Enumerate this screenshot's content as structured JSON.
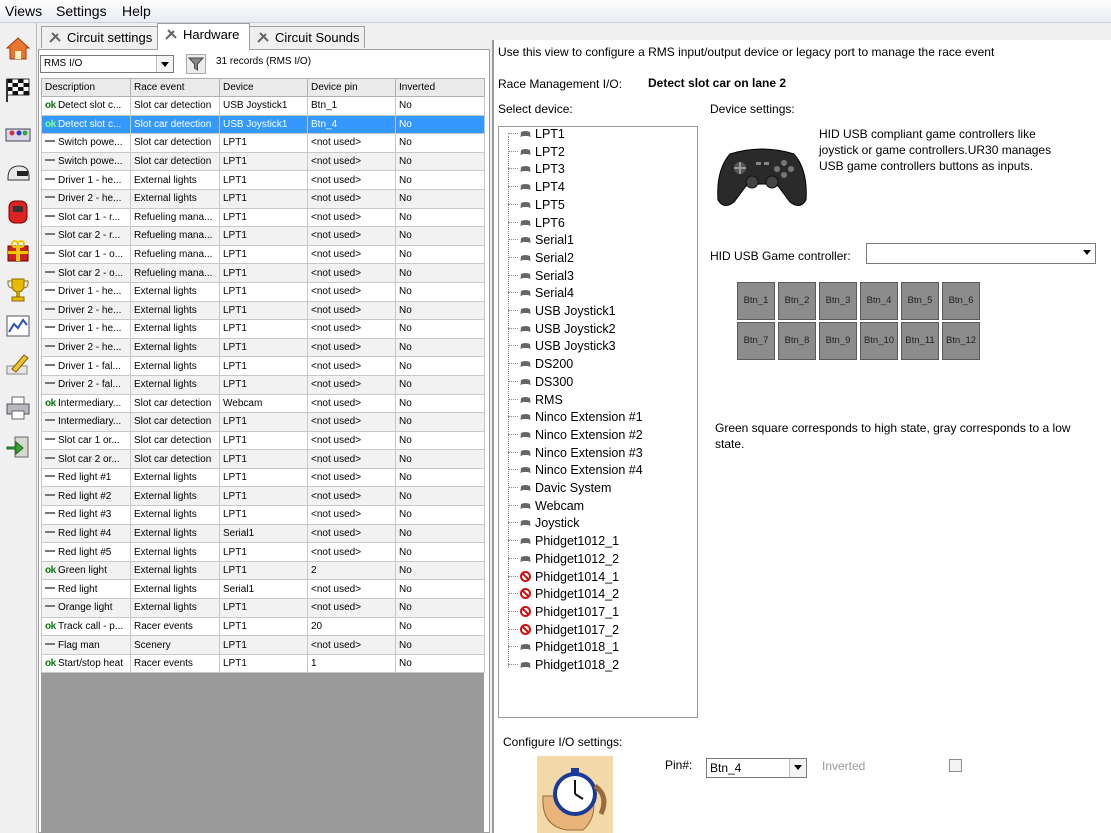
{
  "menu": [
    "Views",
    "Settings",
    "Help"
  ],
  "tabs": [
    {
      "label": "Circuit settings",
      "active": false
    },
    {
      "label": "Hardware",
      "active": true
    },
    {
      "label": "Circuit Sounds",
      "active": false
    }
  ],
  "left": {
    "filter_value": "RMS I/O",
    "record_count": "31 records (RMS I/O)",
    "columns": [
      "Description",
      "Race event",
      "Device",
      "Device pin",
      "Inverted"
    ],
    "rows": [
      {
        "status": "ok",
        "desc": "Detect slot c...",
        "event": "Slot car detection",
        "device": "USB Joystick1",
        "pin": "Btn_1",
        "inv": "No"
      },
      {
        "status": "ok",
        "desc": "Detect slot c...",
        "event": "Slot car detection",
        "device": "USB Joystick1",
        "pin": "Btn_4",
        "inv": "No",
        "selected": true
      },
      {
        "status": "dash",
        "desc": "Switch powe...",
        "event": "Slot car detection",
        "device": "LPT1",
        "pin": "<not used>",
        "inv": "No"
      },
      {
        "status": "dash",
        "desc": "Switch powe...",
        "event": "Slot car detection",
        "device": "LPT1",
        "pin": "<not used>",
        "inv": "No"
      },
      {
        "status": "dash",
        "desc": "Driver 1 - he...",
        "event": "External lights",
        "device": "LPT1",
        "pin": "<not used>",
        "inv": "No"
      },
      {
        "status": "dash",
        "desc": "Driver 2 - he...",
        "event": "External lights",
        "device": "LPT1",
        "pin": "<not used>",
        "inv": "No"
      },
      {
        "status": "dash",
        "desc": "Slot car 1 - r...",
        "event": "Refueling mana...",
        "device": "LPT1",
        "pin": "<not used>",
        "inv": "No"
      },
      {
        "status": "dash",
        "desc": "Slot car 2 - r...",
        "event": "Refueling mana...",
        "device": "LPT1",
        "pin": "<not used>",
        "inv": "No"
      },
      {
        "status": "dash",
        "desc": "Slot car 1 - o...",
        "event": "Refueling mana...",
        "device": "LPT1",
        "pin": "<not used>",
        "inv": "No"
      },
      {
        "status": "dash",
        "desc": "Slot car 2 - o...",
        "event": "Refueling mana...",
        "device": "LPT1",
        "pin": "<not used>",
        "inv": "No"
      },
      {
        "status": "dash",
        "desc": "Driver 1 - he...",
        "event": "External lights",
        "device": "LPT1",
        "pin": "<not used>",
        "inv": "No"
      },
      {
        "status": "dash",
        "desc": "Driver 2 - he...",
        "event": "External lights",
        "device": "LPT1",
        "pin": "<not used>",
        "inv": "No"
      },
      {
        "status": "dash",
        "desc": "Driver 1 - he...",
        "event": "External lights",
        "device": "LPT1",
        "pin": "<not used>",
        "inv": "No"
      },
      {
        "status": "dash",
        "desc": "Driver 2 - he...",
        "event": "External lights",
        "device": "LPT1",
        "pin": "<not used>",
        "inv": "No"
      },
      {
        "status": "dash",
        "desc": "Driver 1 - fal...",
        "event": "External lights",
        "device": "LPT1",
        "pin": "<not used>",
        "inv": "No"
      },
      {
        "status": "dash",
        "desc": "Driver 2 - fal...",
        "event": "External lights",
        "device": "LPT1",
        "pin": "<not used>",
        "inv": "No"
      },
      {
        "status": "ok",
        "desc": "Intermediary...",
        "event": "Slot car detection",
        "device": "Webcam",
        "pin": "<not used>",
        "inv": "No"
      },
      {
        "status": "dash",
        "desc": "Intermediary...",
        "event": "Slot car detection",
        "device": "LPT1",
        "pin": "<not used>",
        "inv": "No"
      },
      {
        "status": "dash",
        "desc": "Slot car 1 or...",
        "event": "Slot car detection",
        "device": "LPT1",
        "pin": "<not used>",
        "inv": "No"
      },
      {
        "status": "dash",
        "desc": "Slot car 2 or...",
        "event": "Slot car detection",
        "device": "LPT1",
        "pin": "<not used>",
        "inv": "No"
      },
      {
        "status": "dash",
        "desc": "Red light #1",
        "event": "External lights",
        "device": "LPT1",
        "pin": "<not used>",
        "inv": "No"
      },
      {
        "status": "dash",
        "desc": "Red light #2",
        "event": "External lights",
        "device": "LPT1",
        "pin": "<not used>",
        "inv": "No"
      },
      {
        "status": "dash",
        "desc": "Red light #3",
        "event": "External lights",
        "device": "LPT1",
        "pin": "<not used>",
        "inv": "No"
      },
      {
        "status": "dash",
        "desc": "Red light #4",
        "event": "External lights",
        "device": "Serial1",
        "pin": "<not used>",
        "inv": "No"
      },
      {
        "status": "dash",
        "desc": "Red light #5",
        "event": "External lights",
        "device": "LPT1",
        "pin": "<not used>",
        "inv": "No"
      },
      {
        "status": "ok",
        "desc": "Green light",
        "event": "External lights",
        "device": "LPT1",
        "pin": "2",
        "inv": "No"
      },
      {
        "status": "dash",
        "desc": "Red light",
        "event": "External lights",
        "device": "Serial1",
        "pin": "<not used>",
        "inv": "No"
      },
      {
        "status": "dash",
        "desc": "Orange light",
        "event": "External lights",
        "device": "LPT1",
        "pin": "<not used>",
        "inv": "No"
      },
      {
        "status": "ok",
        "desc": "Track call - p...",
        "event": "Racer events",
        "device": "LPT1",
        "pin": "20",
        "inv": "No"
      },
      {
        "status": "dash",
        "desc": "Flag man",
        "event": "Scenery",
        "device": "LPT1",
        "pin": "<not used>",
        "inv": "No"
      },
      {
        "status": "ok",
        "desc": "Start/stop heat",
        "event": "Racer events",
        "device": "LPT1",
        "pin": "1",
        "inv": "No"
      }
    ]
  },
  "right": {
    "intro": "Use this view to configure a RMS input/output device or legacy port to manage the race event",
    "rmio_label": "Race Management I/O:",
    "rmio_value": "Detect slot car on lane 2",
    "select_device_label": "Select device:",
    "device_settings_label": "Device settings:",
    "device_description": [
      "HID USB compliant game controllers like",
      "joystick or game controllers.UR30 manages",
      "USB game controllers  buttons as inputs."
    ],
    "hid_label": "HID USB Game controller:",
    "hid_value": "",
    "devices": [
      {
        "name": "LPT1",
        "icon": "gamepad"
      },
      {
        "name": "LPT2",
        "icon": "gamepad"
      },
      {
        "name": "LPT3",
        "icon": "gamepad"
      },
      {
        "name": "LPT4",
        "icon": "gamepad"
      },
      {
        "name": "LPT5",
        "icon": "gamepad"
      },
      {
        "name": "LPT6",
        "icon": "gamepad"
      },
      {
        "name": "Serial1",
        "icon": "gamepad"
      },
      {
        "name": "Serial2",
        "icon": "gamepad"
      },
      {
        "name": "Serial3",
        "icon": "gamepad"
      },
      {
        "name": "Serial4",
        "icon": "gamepad"
      },
      {
        "name": "USB Joystick1",
        "icon": "gamepad"
      },
      {
        "name": "USB Joystick2",
        "icon": "gamepad"
      },
      {
        "name": "USB Joystick3",
        "icon": "gamepad"
      },
      {
        "name": "DS200",
        "icon": "gamepad"
      },
      {
        "name": "DS300",
        "icon": "gamepad"
      },
      {
        "name": "RMS",
        "icon": "gamepad"
      },
      {
        "name": "Ninco Extension #1",
        "icon": "gamepad"
      },
      {
        "name": "Ninco Extension #2",
        "icon": "gamepad"
      },
      {
        "name": "Ninco Extension #3",
        "icon": "gamepad"
      },
      {
        "name": "Ninco Extension #4",
        "icon": "gamepad"
      },
      {
        "name": "Davic System",
        "icon": "gamepad"
      },
      {
        "name": "Webcam",
        "icon": "gamepad"
      },
      {
        "name": "Joystick",
        "icon": "gamepad"
      },
      {
        "name": "Phidget1012_1",
        "icon": "gamepad"
      },
      {
        "name": "Phidget1012_2",
        "icon": "gamepad"
      },
      {
        "name": "Phidget1014_1",
        "icon": "no-entry"
      },
      {
        "name": "Phidget1014_2",
        "icon": "no-entry"
      },
      {
        "name": "Phidget1017_1",
        "icon": "no-entry"
      },
      {
        "name": "Phidget1017_2",
        "icon": "no-entry"
      },
      {
        "name": "Phidget1018_1",
        "icon": "gamepad"
      },
      {
        "name": "Phidget1018_2",
        "icon": "gamepad"
      }
    ],
    "buttons": [
      "Btn_1",
      "Btn_2",
      "Btn_3",
      "Btn_4",
      "Btn_5",
      "Btn_6",
      "Btn_7",
      "Btn_8",
      "Btn_9",
      "Btn_10",
      "Btn_11",
      "Btn_12"
    ],
    "state_note": [
      "Green square corresponds to high state, gray corresponds to a low",
      "state."
    ],
    "configure_label": "Configure I/O settings:",
    "pin_label": "Pin#:",
    "pin_value": "Btn_4",
    "inverted_label": "Inverted",
    "inverted_checked": false
  }
}
